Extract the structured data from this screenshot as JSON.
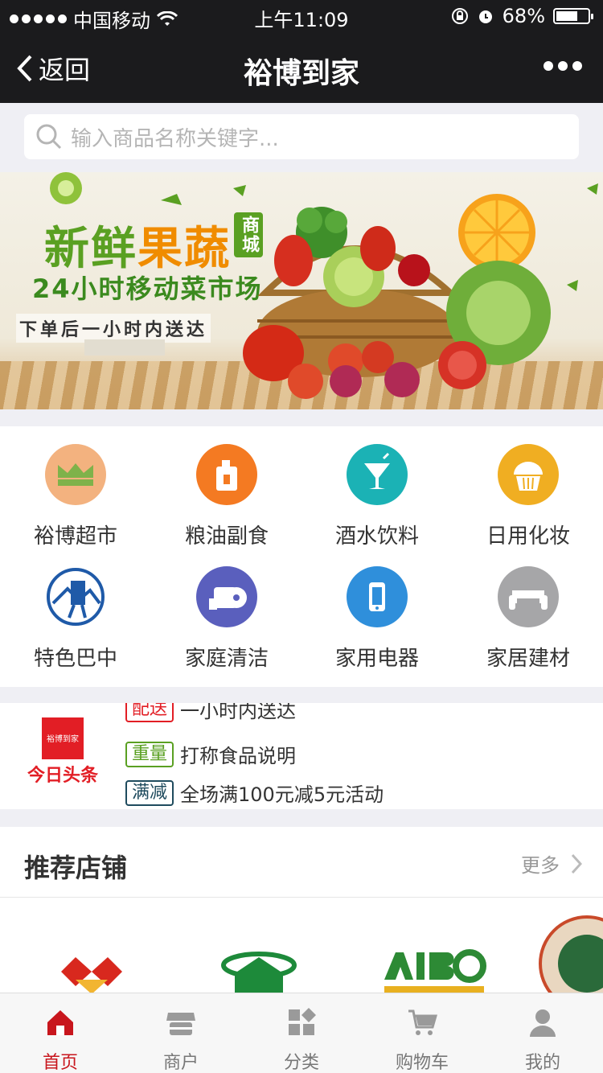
{
  "status_bar": {
    "carrier": "中国移动",
    "time": "上午11:09",
    "battery": "68%",
    "battery_level": 0.68
  },
  "nav": {
    "back_label": "返回",
    "title": "裕博到家"
  },
  "search": {
    "placeholder": "输入商品名称关键字..."
  },
  "banner": {
    "title_part1": "新鲜",
    "title_part2": "果蔬",
    "title_side": "商城",
    "subtitle": "24小时移动菜市场",
    "tagline": "下单后一小时内送达"
  },
  "categories": [
    {
      "label": "裕博超市",
      "icon": "crown-icon",
      "color": "#f3b27f"
    },
    {
      "label": "粮油副食",
      "icon": "oil-bottle-icon",
      "color": "#f47a22"
    },
    {
      "label": "酒水饮料",
      "icon": "cocktail-icon",
      "color": "#1bb2b5"
    },
    {
      "label": "日用化妆",
      "icon": "cupcake-icon",
      "color": "#f0ae22"
    },
    {
      "label": "特色巴中",
      "icon": "porter-icon",
      "color": "#1f5aa8"
    },
    {
      "label": "家庭清洁",
      "icon": "tissue-roll-icon",
      "color": "#5a5fbd"
    },
    {
      "label": "家用电器",
      "icon": "phone-icon",
      "color": "#2f8fdb"
    },
    {
      "label": "家居建材",
      "icon": "sofa-icon",
      "color": "#a6a6a8"
    }
  ],
  "news": {
    "logo_text": "今日头条",
    "logo_box_text": "裕博到家",
    "items": [
      {
        "tag": "配送",
        "text": "一小时内送达",
        "color": "#e21e25"
      },
      {
        "tag": "重量",
        "text": "打称食品说明",
        "color": "#5aa022"
      },
      {
        "tag": "满减",
        "text": "全场满100元减5元活动",
        "color": "#1f4b5e"
      }
    ]
  },
  "recommended": {
    "title": "推荐店铺",
    "more": "更多"
  },
  "tabbar": [
    {
      "label": "首页",
      "icon": "home-icon",
      "active": true
    },
    {
      "label": "商户",
      "icon": "store-icon",
      "active": false
    },
    {
      "label": "分类",
      "icon": "grid-icon",
      "active": false
    },
    {
      "label": "购物车",
      "icon": "cart-icon",
      "active": false
    },
    {
      "label": "我的",
      "icon": "user-icon",
      "active": false
    }
  ]
}
